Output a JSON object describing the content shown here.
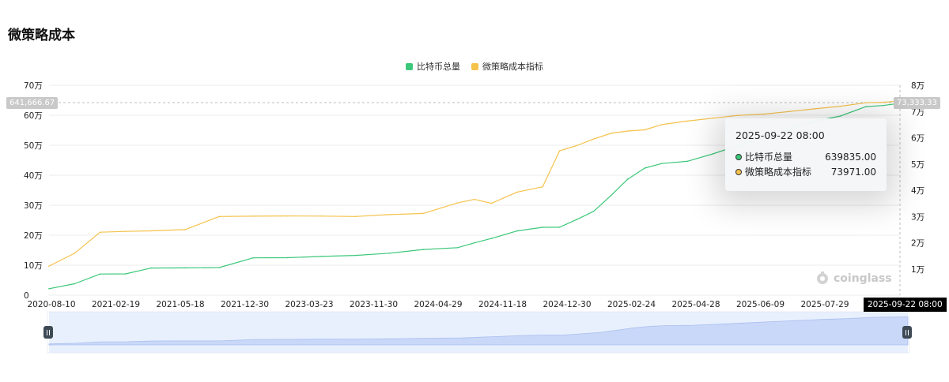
{
  "page": {
    "title": "微策略成本"
  },
  "colors": {
    "btc_total": "#3cc87a",
    "cost_index": "#f5c24c",
    "grid": "#ececec",
    "zoom_fill": "#dbe6fb"
  },
  "tooltip": {
    "time": "2025-09-22 08:00",
    "rows": [
      {
        "name": "比特币总量",
        "value": "639835.00",
        "color": "#3cc87a"
      },
      {
        "name": "微策略成本指标",
        "value": "73971.00",
        "color": "#f5c24c"
      }
    ]
  },
  "axis_pointer": {
    "left_label": "641,666.67",
    "right_label": "73,333.33",
    "x_label": "2025-09-22 08:00"
  },
  "watermark": {
    "text": "coinglass"
  },
  "chart_data": {
    "type": "line",
    "legend": [
      "比特币总量",
      "微策略成本指标"
    ],
    "legend_position": "top-center",
    "grid": true,
    "y_left": {
      "ticks": [
        "0",
        "10万",
        "20万",
        "30万",
        "40万",
        "50万",
        "60万",
        "70万"
      ],
      "range": [
        0,
        700000
      ]
    },
    "y_right": {
      "ticks": [
        "1万",
        "2万",
        "3万",
        "4万",
        "5万",
        "6万",
        "7万",
        "8万"
      ],
      "range": [
        0,
        80000
      ]
    },
    "x_ticks": [
      "2020-08-10",
      "2021-02-19",
      "2021-05-18",
      "2021-12-30",
      "2023-03-23",
      "2023-11-30",
      "2024-04-29",
      "2024-11-18",
      "2024-12-30",
      "2025-02-24",
      "2025-04-28",
      "2025-06-09",
      "2025-07-29"
    ],
    "x": [
      0,
      0.03,
      0.06,
      0.09,
      0.12,
      0.16,
      0.2,
      0.24,
      0.28,
      0.32,
      0.36,
      0.4,
      0.44,
      0.48,
      0.5,
      0.52,
      0.55,
      0.58,
      0.6,
      0.62,
      0.64,
      0.66,
      0.68,
      0.7,
      0.72,
      0.75,
      0.78,
      0.81,
      0.84,
      0.87,
      0.9,
      0.93,
      0.96,
      0.98,
      1.0
    ],
    "series": [
      {
        "name": "比特币总量",
        "axis": "left",
        "values": [
          21454,
          38250,
          70470,
          71079,
          90531,
          91064,
          92079,
          124391,
          125051,
          129218,
          132500,
          140000,
          152333,
          158400,
          174530,
          189150,
          214246,
          226331,
          226500,
          252220,
          279420,
          331200,
          386700,
          423650,
          439000,
          446400,
          471107,
          499096,
          528185,
          553555,
          580250,
          597325,
          628791,
          632457,
          639835
        ]
      },
      {
        "name": "微策略成本指标",
        "axis": "right",
        "values": [
          11111,
          15964,
          24000,
          24300,
          24500,
          25000,
          30000,
          30100,
          30200,
          30150,
          30000,
          30700,
          31168,
          35158,
          36500,
          35000,
          39266,
          41300,
          55000,
          57000,
          59500,
          61650,
          62550,
          63000,
          65000,
          66357,
          67458,
          68500,
          69000,
          70000,
          71000,
          72000,
          73333,
          73500,
          73971
        ]
      }
    ]
  }
}
